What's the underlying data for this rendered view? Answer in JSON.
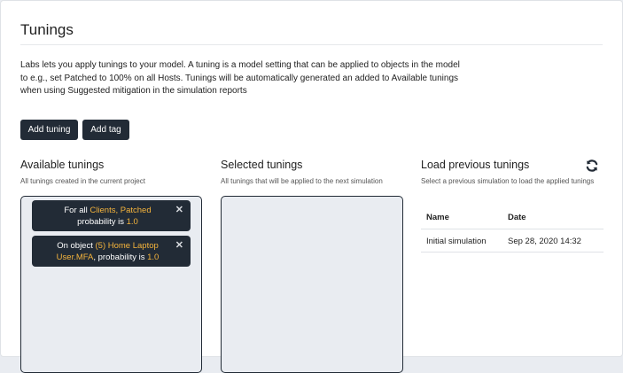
{
  "page": {
    "title": "Tunings",
    "description": "Labs lets you apply tunings to your model. A tuning is a model setting that can be applied to objects in the model to e.g., set Patched to 100% on all Hosts. Tunings will be automatically generated an added to Available tunings when using Suggested mitigation in the simulation reports"
  },
  "toolbar": {
    "add_tuning_label": "Add tuning",
    "add_tag_label": "Add tag"
  },
  "available": {
    "title": "Available tunings",
    "subtitle": "All tunings created in the current project",
    "chips": [
      {
        "prefix": "For all ",
        "highlight": "Clients, Patched",
        "middle": " probability is ",
        "value": "1.0",
        "close": "✕"
      },
      {
        "prefix": "On object ",
        "highlight": "(5) Home Laptop User.MFA",
        "middle": ", probability is ",
        "value": "1.0",
        "close": "✕"
      }
    ]
  },
  "selected": {
    "title": "Selected tunings",
    "subtitle": "All tunings that will be applied to the next simulation"
  },
  "load": {
    "title": "Load previous tunings",
    "subtitle": "Select a previous simulation to load the applied tunings",
    "icon": "refresh-icon",
    "columns": [
      "Name",
      "Date"
    ],
    "rows": [
      [
        "Initial simulation",
        "Sep 28, 2020 14:32"
      ]
    ]
  },
  "colors": {
    "dark": "#222b36",
    "highlight": "#f5b43c",
    "panel_bg": "#e9ecf1"
  }
}
